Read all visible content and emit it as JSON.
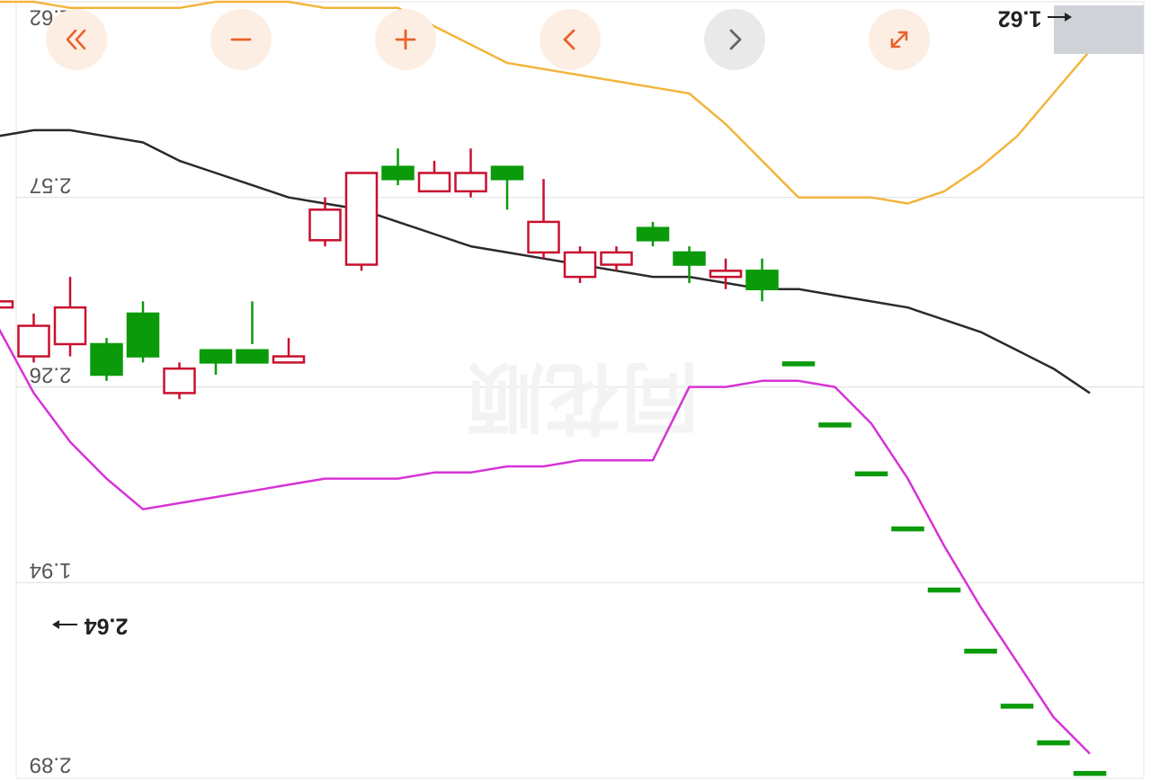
{
  "toolbar": {
    "buttons": [
      {
        "name": "first-page",
        "icon": "double-chevron-left-icon"
      },
      {
        "name": "zoom-out",
        "icon": "minus-icon"
      },
      {
        "name": "zoom-in",
        "icon": "plus-icon"
      },
      {
        "name": "previous",
        "icon": "chevron-left-icon"
      },
      {
        "name": "next",
        "icon": "chevron-right-icon",
        "disabled": true
      },
      {
        "name": "fullscreen",
        "icon": "expand-icon"
      }
    ],
    "accent_color": "#e8622c",
    "disabled_color": "#666666"
  },
  "watermark": "同花顺",
  "chart_data": {
    "type": "candlestick",
    "orientation": "rotated-180",
    "price_axis": {
      "labels": [
        "2.89",
        "2.57",
        "2.26",
        "1.94",
        "1.62"
      ],
      "range": [
        2.89,
        1.62
      ]
    },
    "markers": {
      "high": {
        "label": "1.62",
        "value": 1.62
      },
      "low": {
        "label": "2.64",
        "value": 2.64
      }
    },
    "colors": {
      "up": "#c8102e",
      "down": "#0a9a0a",
      "ma1": "#d633d6",
      "ma2": "#2a2a2a",
      "ma3": "#f2b53c"
    },
    "candles": [
      {
        "open": 1.63,
        "close": 1.63,
        "high": 1.63,
        "low": 1.63
      },
      {
        "open": 1.68,
        "close": 1.68,
        "high": 1.68,
        "low": 1.68
      },
      {
        "open": 1.74,
        "close": 1.74,
        "high": 1.74,
        "low": 1.74
      },
      {
        "open": 1.83,
        "close": 1.83,
        "high": 1.83,
        "low": 1.83
      },
      {
        "open": 1.93,
        "close": 1.93,
        "high": 1.93,
        "low": 1.93
      },
      {
        "open": 2.03,
        "close": 2.03,
        "high": 2.03,
        "low": 2.03
      },
      {
        "open": 2.12,
        "close": 2.12,
        "high": 2.12,
        "low": 2.12
      },
      {
        "open": 2.2,
        "close": 2.2,
        "high": 2.2,
        "low": 2.2
      },
      {
        "open": 2.3,
        "close": 2.3,
        "high": 2.3,
        "low": 2.3
      },
      {
        "open": 2.42,
        "close": 2.45,
        "high": 2.4,
        "low": 2.47
      },
      {
        "open": 2.45,
        "close": 2.44,
        "high": 2.42,
        "low": 2.47
      },
      {
        "open": 2.46,
        "close": 2.48,
        "high": 2.43,
        "low": 2.49
      },
      {
        "open": 2.5,
        "close": 2.52,
        "high": 2.49,
        "low": 2.53
      },
      {
        "open": 2.48,
        "close": 2.46,
        "high": 2.45,
        "low": 2.49
      },
      {
        "open": 2.48,
        "close": 2.44,
        "high": 2.43,
        "low": 2.49
      },
      {
        "open": 2.53,
        "close": 2.48,
        "high": 2.47,
        "low": 2.6
      },
      {
        "open": 2.6,
        "close": 2.62,
        "high": 2.55,
        "low": 2.62
      },
      {
        "open": 2.61,
        "close": 2.58,
        "high": 2.57,
        "low": 2.65
      },
      {
        "open": 2.61,
        "close": 2.58,
        "high": 2.58,
        "low": 2.63
      },
      {
        "open": 2.6,
        "close": 2.62,
        "high": 2.59,
        "low": 2.65
      },
      {
        "open": 2.61,
        "close": 2.46,
        "high": 2.45,
        "low": 2.61
      },
      {
        "open": 2.55,
        "close": 2.5,
        "high": 2.49,
        "low": 2.57
      },
      {
        "open": 2.31,
        "close": 2.3,
        "high": 2.3,
        "low": 2.34
      },
      {
        "open": 2.3,
        "close": 2.32,
        "high": 2.33,
        "low": 2.4
      },
      {
        "open": 2.3,
        "close": 2.32,
        "high": 2.28,
        "low": 2.32
      },
      {
        "open": 2.29,
        "close": 2.25,
        "high": 2.24,
        "low": 2.3
      },
      {
        "open": 2.31,
        "close": 2.38,
        "high": 2.3,
        "low": 2.4
      },
      {
        "open": 2.28,
        "close": 2.33,
        "high": 2.27,
        "low": 2.34
      },
      {
        "open": 2.39,
        "close": 2.33,
        "high": 2.31,
        "low": 2.44
      },
      {
        "open": 2.36,
        "close": 2.31,
        "high": 2.3,
        "low": 2.38
      },
      {
        "open": 2.4,
        "close": 2.39,
        "high": 2.37,
        "low": 2.43
      },
      {
        "open": 2.39,
        "close": 2.29,
        "high": 2.29,
        "low": 2.44
      },
      {
        "open": 2.54,
        "close": 2.6,
        "high": 2.53,
        "low": 2.62
      }
    ],
    "ma1": [
      1.66,
      1.72,
      1.81,
      1.9,
      2.0,
      2.11,
      2.2,
      2.26,
      2.27,
      2.27,
      2.26,
      2.26,
      2.14,
      2.14,
      2.14,
      2.13,
      2.13,
      2.12,
      2.12,
      2.11,
      2.11,
      2.11,
      2.1,
      2.09,
      2.08,
      2.07,
      2.06,
      2.11,
      2.17,
      2.25,
      2.36,
      2.35,
      2.34
    ],
    "ma2": [
      2.25,
      2.29,
      2.32,
      2.35,
      2.37,
      2.39,
      2.4,
      2.41,
      2.42,
      2.42,
      2.43,
      2.44,
      2.44,
      2.45,
      2.46,
      2.47,
      2.48,
      2.49,
      2.51,
      2.53,
      2.55,
      2.56,
      2.57,
      2.59,
      2.61,
      2.63,
      2.66,
      2.67,
      2.68,
      2.68,
      2.67,
      2.65,
      2.64
    ],
    "ma3": [
      2.81,
      2.74,
      2.67,
      2.62,
      2.58,
      2.56,
      2.57,
      2.57,
      2.57,
      2.63,
      2.69,
      2.74,
      2.75,
      2.76,
      2.77,
      2.78,
      2.79,
      2.82,
      2.85,
      2.88,
      2.88,
      2.88,
      2.89,
      2.89,
      2.89,
      2.88,
      2.88,
      2.88,
      2.88,
      2.89,
      2.89,
      2.89,
      2.89
    ]
  }
}
